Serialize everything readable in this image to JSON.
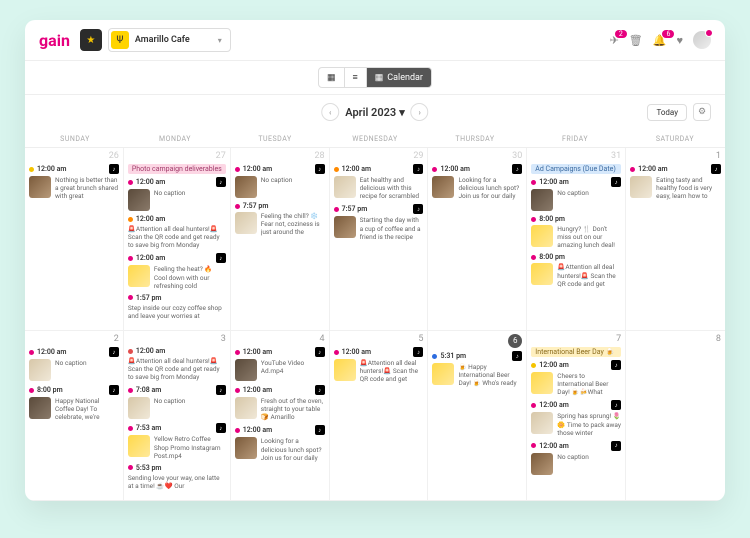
{
  "brand": {
    "logo": "gain",
    "workspace_icon": "★",
    "account_icon": "Ψ",
    "account_name": "Amarillo Cafe"
  },
  "top_icons": {
    "send": "✈",
    "send_badge": "2",
    "inbox": "🗑",
    "bell": "🔔",
    "bell_badge": "6",
    "heart": "♥"
  },
  "view": {
    "grid": "▦",
    "list": "≡",
    "calendar_icon": "▦",
    "calendar_label": "Calendar"
  },
  "nav": {
    "prev": "‹",
    "next": "›",
    "month": "April 2023",
    "dd": "▾",
    "today": "Today",
    "gear": "⚙"
  },
  "days": [
    "SUNDAY",
    "MONDAY",
    "TUESDAY",
    "WEDNESDAY",
    "THURSDAY",
    "FRIDAY",
    "SATURDAY"
  ],
  "cells": [
    {
      "num": "26",
      "other": true,
      "posts": [
        {
          "dot": "yellow",
          "time": "12:00 am",
          "tt": true,
          "thumb": "br",
          "cap": "Nothing is better than a great brunch shared with great"
        }
      ]
    },
    {
      "num": "27",
      "other": true,
      "banner": {
        "cls": "pink",
        "text": "Photo campaign deliverables"
      },
      "posts": [
        {
          "dot": "pink",
          "time": "12:00 am",
          "tt": true,
          "thumb": "dk",
          "cap": "No caption"
        },
        {
          "dot": "orange",
          "time": "12:00 am",
          "cap": "🚨Attention all deal hunters!🚨 Scan the QR code and get ready to save big from Monday"
        },
        {
          "dot": "pink",
          "time": "12:00 am",
          "tt": true,
          "thumb": "y",
          "cap": "Feeling the heat? 🔥 Cool down with our refreshing cold"
        },
        {
          "dot": "pink",
          "time": "1:57 pm",
          "cap": "Step inside our cozy coffee shop and leave your worries at"
        }
      ]
    },
    {
      "num": "28",
      "other": true,
      "posts": [
        {
          "dot": "pink",
          "time": "12:00 am",
          "tt": true,
          "thumb": "br",
          "cap": "No caption"
        },
        {
          "dot": "pink",
          "time": "7:57 pm",
          "thumb": "",
          "cap": "Feeling the chill? ❄️ Fear not, coziness is just around the"
        }
      ]
    },
    {
      "num": "29",
      "other": true,
      "posts": [
        {
          "dot": "orange",
          "time": "12:00 am",
          "tt": true,
          "thumb": "",
          "cap": "Eat healthy and delicious with this recipe for scrambled"
        },
        {
          "dot": "pink",
          "time": "7:57 pm",
          "tt": true,
          "thumb": "br",
          "cap": "Starting the day with a cup of coffee and a friend is the recipe"
        }
      ]
    },
    {
      "num": "30",
      "other": true,
      "posts": [
        {
          "dot": "pink",
          "time": "12:00 am",
          "tt": true,
          "thumb": "br",
          "cap": "Looking for a delicious lunch spot? Join us for our daily"
        }
      ]
    },
    {
      "num": "31",
      "other": true,
      "banner": {
        "cls": "blue",
        "text": "Ad Campaigns (Due Date)"
      },
      "posts": [
        {
          "dot": "pink",
          "time": "12:00 am",
          "tt": true,
          "thumb": "dk",
          "cap": "No caption"
        },
        {
          "dot": "pink",
          "time": "8:00 pm",
          "thumb": "y",
          "cap": "Hungry? 🍴 Don't miss out on our amazing lunch deal!"
        },
        {
          "dot": "pink",
          "time": "8:00 pm",
          "thumb": "y",
          "cap": "🚨Attention all deal hunters!🚨 Scan the QR code and get"
        }
      ]
    },
    {
      "num": "1",
      "posts": [
        {
          "dot": "pink",
          "time": "12:00 am",
          "tt": true,
          "thumb": "",
          "cap": "Eating tasty and healthy food is very easy, learn how to"
        }
      ]
    },
    {
      "num": "2",
      "posts": [
        {
          "dot": "pink",
          "time": "12:00 am",
          "tt": true,
          "thumb": "",
          "cap": "No caption"
        },
        {
          "dot": "pink",
          "time": "8:00 pm",
          "tt": true,
          "thumb": "dk",
          "cap": "Happy National Coffee Day! To celebrate, we're"
        }
      ]
    },
    {
      "num": "3",
      "posts": [
        {
          "dot": "red",
          "time": "12:00 am",
          "cap": "🚨Attention all deal hunters!🚨 Scan the QR code and get ready to save big from Monday"
        },
        {
          "dot": "pink",
          "time": "7:08 am",
          "tt": true,
          "thumb": "",
          "cap": "No caption"
        },
        {
          "dot": "pink",
          "time": "7:53 am",
          "tt": true,
          "thumb": "y",
          "cap": "Yellow Retro Coffee Shop Promo Instagram Post.mp4"
        },
        {
          "dot": "pink",
          "time": "5:53 pm",
          "cap": "Sending love your way, one latte at a time! ☕️❤️ Our"
        }
      ]
    },
    {
      "num": "4",
      "posts": [
        {
          "dot": "pink",
          "time": "12:00 am",
          "tt": true,
          "thumb": "dk",
          "cap": "YouTube Video Ad.mp4"
        },
        {
          "dot": "pink",
          "time": "12:00 am",
          "tt": true,
          "thumb": "",
          "cap": "Fresh out of the oven, straight to your table 🍞 Amarillo"
        },
        {
          "dot": "pink",
          "time": "12:00 am",
          "tt": true,
          "thumb": "br",
          "cap": "Looking for a delicious lunch spot? Join us for our daily"
        }
      ]
    },
    {
      "num": "5",
      "posts": [
        {
          "dot": "pink",
          "time": "12:00 am",
          "tt": true,
          "thumb": "y",
          "cap": "🚨Attention all deal hunters!🚨 Scan the QR code and get"
        }
      ]
    },
    {
      "num": "6",
      "today": true,
      "posts": [
        {
          "dot": "blue",
          "time": "5:31 pm",
          "tt": true,
          "thumb": "y",
          "cap": "🍺 Happy International Beer Day! 🍺 Who's ready"
        }
      ]
    },
    {
      "num": "7",
      "banner": {
        "cls": "yellow",
        "text": "International Beer Day 🍺"
      },
      "posts": [
        {
          "dot": "yellow",
          "time": "12:00 am",
          "tt": true,
          "thumb": "y",
          "cap": "Cheers to International Beer Day! 🍺🍻What"
        },
        {
          "dot": "pink",
          "time": "12:00 am",
          "tt": true,
          "thumb": "",
          "cap": "Spring has sprung! 🌷🌼 Time to pack away those winter"
        },
        {
          "dot": "pink",
          "time": "12:00 am",
          "tt": true,
          "thumb": "br",
          "cap": "No caption"
        }
      ]
    },
    {
      "num": "8",
      "posts": []
    }
  ]
}
